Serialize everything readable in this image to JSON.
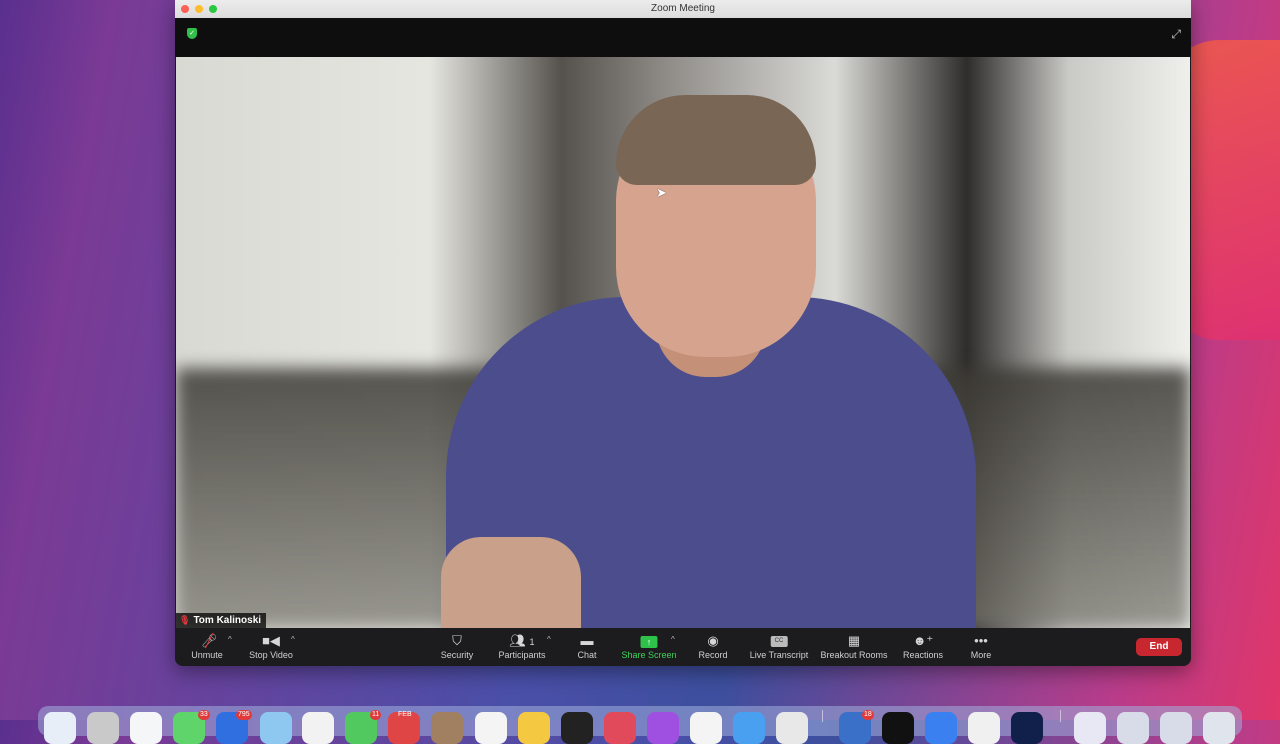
{
  "window": {
    "title": "Zoom Meeting"
  },
  "icons": {
    "security": "shield-check-icon",
    "fullscreen": "expand-icon"
  },
  "video": {
    "participant_name": "Tom Kalinoski",
    "muted": true
  },
  "toolbar": {
    "unmute": "Unmute",
    "stop_video": "Stop Video",
    "security": "Security",
    "participants": "Participants",
    "participants_count": "1",
    "chat": "Chat",
    "share_screen": "Share Screen",
    "record": "Record",
    "live_transcript": "Live Transcript",
    "cc": "CC",
    "breakout_rooms": "Breakout Rooms",
    "reactions": "Reactions",
    "more": "More",
    "end": "End"
  },
  "colors": {
    "share_green": "#2fc24a",
    "end_red": "#c8272f"
  },
  "dock": {
    "badges": [
      "33",
      "795",
      "11",
      "18"
    ],
    "calendar_month": "FEB"
  }
}
